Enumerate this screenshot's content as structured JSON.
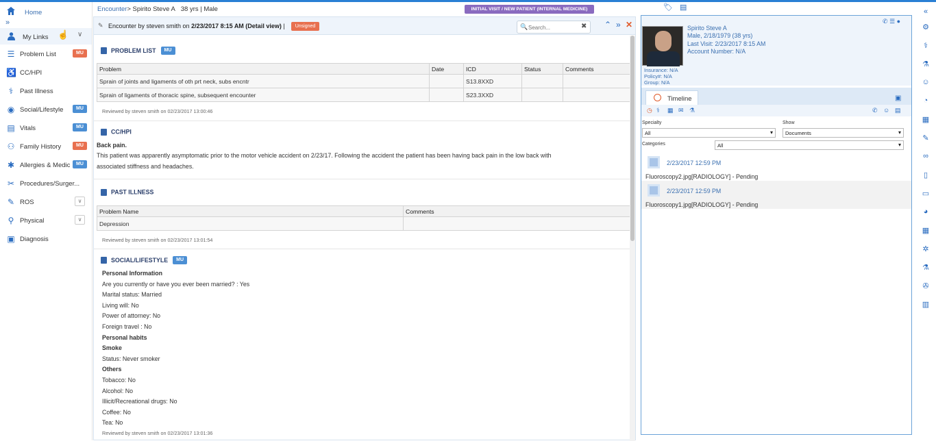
{
  "sidebar": {
    "home": "Home",
    "expand": "»",
    "my_links": "My Links",
    "items": [
      {
        "label": "Problem List",
        "badge": "MU",
        "badge_color": "#e8704f",
        "icon": "list-icon"
      },
      {
        "label": "CC/HPI",
        "icon": "wheelchair-icon"
      },
      {
        "label": "Past Illness",
        "icon": "stethoscope-icon"
      },
      {
        "label": "Social/Lifestyle",
        "badge": "MU",
        "badge_color": "#4b8fd4",
        "icon": "globe-icon"
      },
      {
        "label": "Vitals",
        "badge": "MU",
        "badge_color": "#4b8fd4",
        "icon": "clipboard-icon"
      },
      {
        "label": "Family History",
        "badge": "MU",
        "badge_color": "#e8704f",
        "icon": "family-icon"
      },
      {
        "label": "Allergies & Medic",
        "badge": "MU",
        "badge_color": "#4b8fd4",
        "icon": "allergy-icon"
      },
      {
        "label": "Procedures/Surger...",
        "icon": "procedures-icon"
      },
      {
        "label": "ROS",
        "dropdown": "∨",
        "icon": "edit-icon"
      },
      {
        "label": "Physical",
        "dropdown": "∨",
        "icon": "user-icon"
      },
      {
        "label": "Diagnosis",
        "icon": "diagnosis-icon"
      }
    ]
  },
  "header": {
    "crumb_link": "Encounter",
    "crumb_sep": ">",
    "patient": "Spirito Steve A",
    "age": "38 yrs",
    "sep": "|",
    "sex": "Male",
    "visit_type": "INITIAL VISIT / NEW PATIENT (INTERNAL MEDICINE)"
  },
  "encounter": {
    "title_prefix": "Encounter by steven smith on",
    "title_date": "2/23/2017 8:15 AM (Detail view)",
    "title_sep": "|",
    "status": "Unsigned",
    "search_placeholder": "Search...",
    "problem_list": {
      "title": "PROBLEM LIST",
      "badge": "MU",
      "columns": [
        "Problem",
        "Date",
        "ICD",
        "Status",
        "Comments"
      ],
      "rows": [
        [
          "Sprain of joints and ligaments of oth prt neck, subs encntr",
          "",
          "S13.8XXD",
          "",
          ""
        ],
        [
          "Sprain of ligaments of thoracic spine, subsequent encounter",
          "",
          "S23.3XXD",
          "",
          ""
        ]
      ],
      "reviewed": "Reviewed by steven smith on 02/23/2017 13:00:46"
    },
    "cc_hpi": {
      "title": "CC/HPI",
      "chief": "Back pain.",
      "text1": "This patient was apparently asymptomatic prior to the motor vehicle accident on 2/23/17. Following the accident the patient has been having back pain in the low back with",
      "text2": "associated stiffness and headaches."
    },
    "past_illness": {
      "title": "PAST ILLNESS",
      "columns": [
        "Problem Name",
        "Comments"
      ],
      "rows": [
        [
          "Depression",
          ""
        ]
      ],
      "reviewed": "Reviewed by steven smith on 02/23/2017 13:01:54"
    },
    "social": {
      "title": "SOCIAL/LIFESTYLE",
      "badge": "MU",
      "lines": [
        {
          "text": "Personal Information",
          "bold": true
        },
        {
          "text": "Are you currently or have you ever been married? : Yes",
          "bold": false
        },
        {
          "text": "Marital status: Married",
          "bold": false
        },
        {
          "text": "Living will: No",
          "bold": false
        },
        {
          "text": "Power of attorney: No",
          "bold": false
        },
        {
          "text": "Foreign travel : No",
          "bold": false
        },
        {
          "text": "Personal habits",
          "bold": true
        },
        {
          "text": "Smoke",
          "bold": true
        },
        {
          "text": "Status: Never smoker",
          "bold": false
        },
        {
          "text": "Others",
          "bold": true
        },
        {
          "text": "Tobacco: No",
          "bold": false
        },
        {
          "text": "Alcohol: No",
          "bold": false
        },
        {
          "text": "Illicit/Recreational drugs: No",
          "bold": false
        },
        {
          "text": "Coffee: No",
          "bold": false
        },
        {
          "text": "Tea: No",
          "bold": false
        }
      ],
      "reviewed": "Reviewed by steven smith on 02/23/2017 13:01:36"
    }
  },
  "patient_panel": {
    "name": "Spirito Steve A",
    "demo": "Male, 2/18/1979 (38 yrs)",
    "last_visit": "Last Visit: 2/23/2017 8:15 AM",
    "account": "Account Number: N/A",
    "insurance": "Insurance: N/A",
    "policy": "Policy#: N/A",
    "group": "Group: N/A",
    "timeline_tab": "Timeline",
    "specialty_label": "Specialty",
    "specialty_value": "All",
    "show_label": "Show",
    "show_value": "Documents",
    "categories_label": "Categories",
    "categories_value": "All",
    "entries": [
      {
        "date": "2/23/2017 12:59 PM",
        "file": "Fluoroscopy2.jpg[RADIOLOGY] - Pending"
      },
      {
        "date": "2/23/2017 12:59 PM",
        "file": "Fluoroscopy1.jpg[RADIOLOGY] - Pending"
      }
    ]
  }
}
